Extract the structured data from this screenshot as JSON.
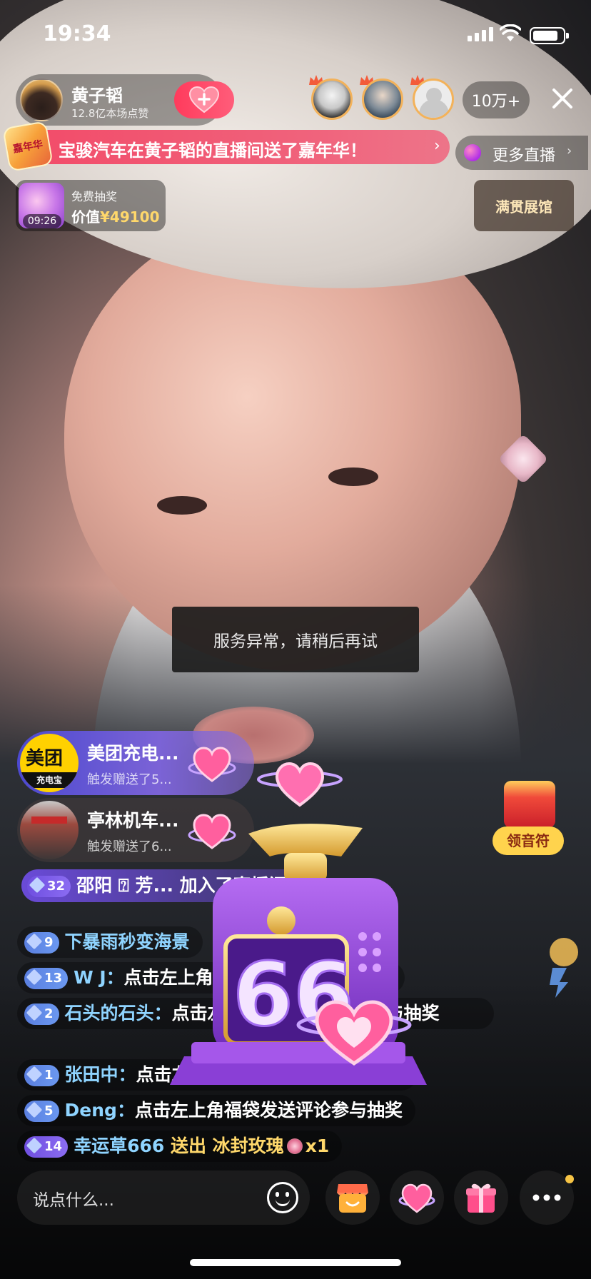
{
  "status_bar": {
    "time": "19:34"
  },
  "host": {
    "name": "黄子韬",
    "likes": "12.8亿本场点赞"
  },
  "viewers": {
    "count": "10万+"
  },
  "banner": {
    "badge": "嘉年华",
    "text": "宝骏汽车在黄子韬的直播间送了嘉年华！",
    "chevron": "›"
  },
  "more_live": {
    "label": "更多直播",
    "chevron": "›"
  },
  "lottery": {
    "title": "免费抽奖",
    "value_prefix": "价值",
    "value": "¥49100",
    "timer": "09:26"
  },
  "showroom": {
    "label": "满贯展馆"
  },
  "toast": {
    "text": "服务异常，请稍后再试"
  },
  "gift_notifications": [
    {
      "name": "美团充电...",
      "sub": "触发赠送了5...",
      "logo_main": "美团",
      "logo_sub": "充电宝"
    },
    {
      "name": "亭林机车...",
      "sub": "触发赠送了6..."
    }
  ],
  "join_message": {
    "level": "32",
    "text": "邵阳 ⍰ 芳... 加入了直播间"
  },
  "chat": [
    {
      "level": "9",
      "nick": "下暴雨秒变海景",
      "sep": "",
      "body": ""
    },
    {
      "level": "13",
      "nick": "W J",
      "sep": "：",
      "body": "点击左上角福袋发送评论参与抽奖"
    },
    {
      "level": "2",
      "nick": "石头的石头",
      "sep": "：",
      "body": "点击左上角福袋发送评论参与抽奖"
    },
    {
      "level": "1",
      "nick": "张田中",
      "sep": "：",
      "body": "点击左上角福袋发送评论参与抽奖"
    },
    {
      "level": "5",
      "nick": "Deng",
      "sep": "：",
      "body": "点击左上角福袋发送评论参与抽奖"
    },
    {
      "level": "14",
      "nick": "幸运草666",
      "sep": " ",
      "body": "送出 冰封玫瑰",
      "suffix": "x1"
    }
  ],
  "animation": {
    "digits": "66"
  },
  "red_packet": {
    "label": "领音符"
  },
  "input": {
    "placeholder": "说点什么..."
  },
  "colors": {
    "accent_pink": "#ff3b5c",
    "nick_blue": "#8fd4ff",
    "gold": "#ffd86b",
    "purple": "#7b63d6"
  }
}
